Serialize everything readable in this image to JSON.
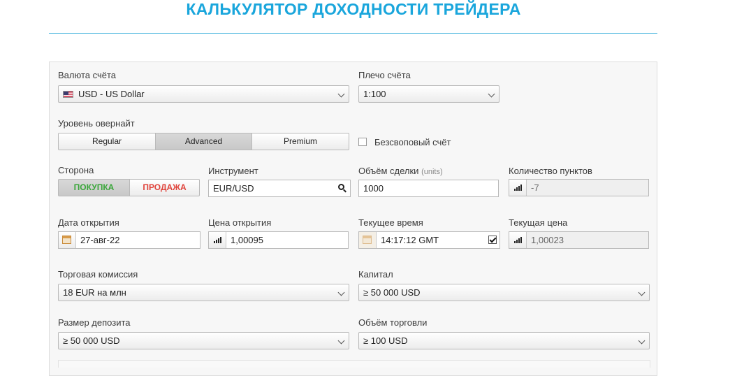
{
  "title": "КАЛЬКУЛЯТОР ДОХОДНОСТИ ТРЕЙДЕРА",
  "account_currency": {
    "label": "Валюта счёта",
    "value": "USD - US Dollar",
    "flag_icon": "us-flag-icon"
  },
  "leverage": {
    "label": "Плечо счёта",
    "value": "1:100"
  },
  "overnight": {
    "label": "Уровень овернайт",
    "options": [
      "Regular",
      "Advanced",
      "Premium"
    ],
    "selected": "Advanced"
  },
  "swap_free": {
    "label": "Безсвоповый счёт",
    "checked": false
  },
  "side": {
    "label": "Сторона",
    "buy": "ПОКУПКА",
    "sell": "ПРОДАЖА",
    "selected": "ПОКУПКА",
    "buy_color": "#3aa63a",
    "sell_color": "#e0443c"
  },
  "instrument": {
    "label": "Инструмент",
    "value": "EUR/USD"
  },
  "volume": {
    "label": "Объём сделки",
    "unit": "(units)",
    "value": "1000"
  },
  "points": {
    "label": "Количество пунктов",
    "value": "-7"
  },
  "open_date": {
    "label": "Дата открытия",
    "value": "27-авг-22"
  },
  "open_price": {
    "label": "Цена открытия",
    "value": "1,00095"
  },
  "current_time": {
    "label": "Текущее время",
    "value": "14:17:12 GMT",
    "checked": true
  },
  "current_price": {
    "label": "Текущая цена",
    "value": "1,00023"
  },
  "commission": {
    "label": "Торговая комиссия",
    "value": "18 EUR на млн"
  },
  "capital": {
    "label": "Капитал",
    "value": "≥ 50 000 USD"
  },
  "deposit": {
    "label": "Размер депозита",
    "value": "≥ 50 000 USD"
  },
  "trade_volume": {
    "label": "Объём торговли",
    "value": "≥ 100 USD"
  },
  "colors": {
    "accent": "#1aa6dc"
  }
}
